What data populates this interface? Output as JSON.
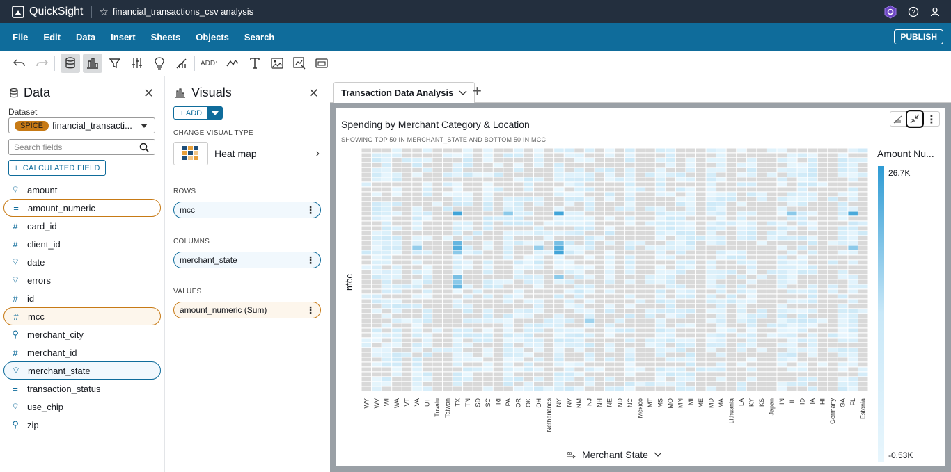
{
  "app": {
    "name": "QuickSight",
    "analysis_title": "financial_transactions_csv analysis"
  },
  "menu": [
    "File",
    "Edit",
    "Data",
    "Insert",
    "Sheets",
    "Objects",
    "Search"
  ],
  "publish_label": "PUBLISH",
  "toolbar": {
    "add_label": "ADD:"
  },
  "data_panel": {
    "title": "Data",
    "dataset_label": "Dataset",
    "spice": "SPICE",
    "dataset_name": "financial_transacti...",
    "search_placeholder": "Search fields",
    "calc_field": "CALCULATED FIELD",
    "fields": [
      {
        "name": "amount",
        "icon": "tag"
      },
      {
        "name": "amount_numeric",
        "icon": "measure"
      },
      {
        "name": "card_id",
        "icon": "hash"
      },
      {
        "name": "client_id",
        "icon": "hash"
      },
      {
        "name": "date",
        "icon": "tag"
      },
      {
        "name": "errors",
        "icon": "tag"
      },
      {
        "name": "id",
        "icon": "hash"
      },
      {
        "name": "mcc",
        "icon": "hash"
      },
      {
        "name": "merchant_city",
        "icon": "geo"
      },
      {
        "name": "merchant_id",
        "icon": "hash"
      },
      {
        "name": "merchant_state",
        "icon": "tag"
      },
      {
        "name": "transaction_status",
        "icon": "measure"
      },
      {
        "name": "use_chip",
        "icon": "tag"
      },
      {
        "name": "zip",
        "icon": "geo"
      }
    ]
  },
  "visuals_panel": {
    "title": "Visuals",
    "add": "+ ADD",
    "change_type_label": "CHANGE VISUAL TYPE",
    "visual_type": "Heat map",
    "rows_label": "ROWS",
    "rows_field": "mcc",
    "columns_label": "COLUMNS",
    "columns_field": "merchant_state",
    "values_label": "VALUES",
    "values_field": "amount_numeric (Sum)"
  },
  "sheet_tab": "Transaction Data Analysis",
  "visual": {
    "title": "Spending by Merchant Category & Location",
    "subtitle": "SHOWING TOP 50 IN MERCHANT_STATE AND BOTTOM 50 IN MCC",
    "y_axis_label": "mcc",
    "x_axis_label": "Merchant State",
    "legend_title": "Amount Nu...",
    "legend_max": "26.7K",
    "legend_min": "-0.53K"
  },
  "chart_data": {
    "type": "heatmap",
    "x": [
      "WY",
      "WV",
      "WI",
      "WA",
      "VT",
      "VA",
      "UT",
      "Tuvalu",
      "Taiwan",
      "TX",
      "TN",
      "SD",
      "SC",
      "RI",
      "PA",
      "OR",
      "OK",
      "OH",
      "Netherlands",
      "NY",
      "NV",
      "NM",
      "NJ",
      "NH",
      "NE",
      "ND",
      "NC",
      "Mexico",
      "MT",
      "MS",
      "MO",
      "MN",
      "MI",
      "ME",
      "MD",
      "MA",
      "Lithuania",
      "LA",
      "KY",
      "KS",
      "Japan",
      "IN",
      "IL",
      "ID",
      "IA",
      "HI",
      "Germany",
      "GA",
      "FL",
      "Estonia"
    ],
    "xlabel": "Merchant State",
    "ylabel": "mcc",
    "rows": 50,
    "value_range": [
      -530,
      26700
    ],
    "highlights": [
      {
        "x": "TX",
        "row": 13,
        "level": 0.9
      },
      {
        "x": "TX",
        "row": 19,
        "level": 0.7
      },
      {
        "x": "TX",
        "row": 20,
        "level": 0.8
      },
      {
        "x": "TX",
        "row": 21,
        "level": 0.5
      },
      {
        "x": "TX",
        "row": 26,
        "level": 0.6
      },
      {
        "x": "TX",
        "row": 27,
        "level": 0.5
      },
      {
        "x": "TX",
        "row": 28,
        "level": 0.7
      },
      {
        "x": "NY",
        "row": 13,
        "level": 0.9
      },
      {
        "x": "NY",
        "row": 19,
        "level": 0.6
      },
      {
        "x": "NY",
        "row": 20,
        "level": 0.8
      },
      {
        "x": "NY",
        "row": 21,
        "level": 0.9
      },
      {
        "x": "NY",
        "row": 26,
        "level": 0.5
      },
      {
        "x": "FL",
        "row": 13,
        "level": 0.85
      },
      {
        "x": "FL",
        "row": 20,
        "level": 0.5
      },
      {
        "x": "PA",
        "row": 13,
        "level": 0.5
      },
      {
        "x": "VA",
        "row": 20,
        "level": 0.45
      },
      {
        "x": "OH",
        "row": 20,
        "level": 0.45
      },
      {
        "x": "NJ",
        "row": 35,
        "level": 0.4
      },
      {
        "x": "IL",
        "row": 13,
        "level": 0.5
      }
    ]
  }
}
